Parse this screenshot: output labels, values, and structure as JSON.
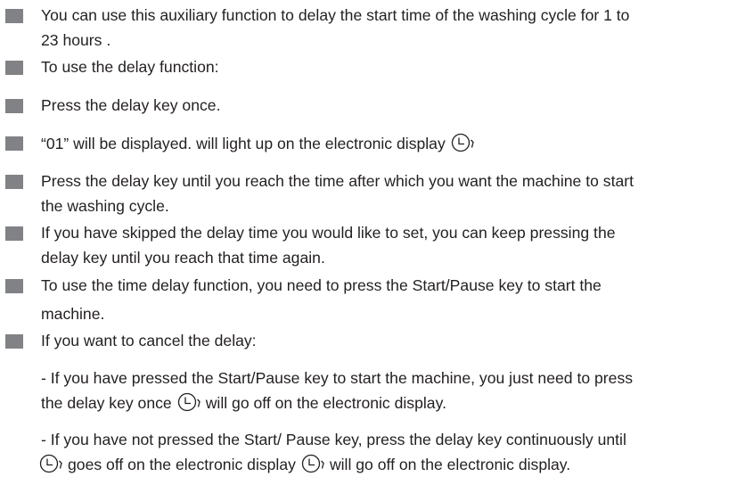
{
  "items": [
    {
      "lines": [
        "You can use this auxiliary function to delay the start time of the washing cycle for 1 to",
        "23 hours ."
      ]
    },
    {
      "lines": [
        "To use the delay function:"
      ]
    },
    {
      "lines": [
        "Press the delay key once."
      ]
    },
    {
      "lines": [
        "“01” will be displayed. will light up on the electronic display"
      ]
    },
    {
      "lines": [
        "Press the delay key until you reach the time after which you want the machine to start",
        "the washing cycle."
      ]
    },
    {
      "lines": [
        "If you have skipped the delay time you would like to set, you can keep pressing the",
        "delay key until you reach that time again."
      ]
    },
    {
      "lines": [
        "To use the time delay function, you need to press the Start/Pause key to start the",
        "machine."
      ]
    },
    {
      "lines": [
        "If you want to cancel the delay:"
      ]
    }
  ],
  "sub_paragraphs": {
    "p1_line1": "- If you have pressed the Start/Pause key to start the machine, you just need to press",
    "p1_line2_before": "the delay key once",
    "p1_line2_after": "will go off on the electronic display.",
    "p2_line1": "- If you have not pressed the Start/ Pause key, press the delay key continuously until",
    "p2_line2_mid": "goes off on the electronic display",
    "p2_line2_after": "will go off on the electronic display."
  },
  "icons": {
    "delay": "delay-clock-icon"
  },
  "colors": {
    "bullet": "#808285",
    "text": "#231f20"
  }
}
